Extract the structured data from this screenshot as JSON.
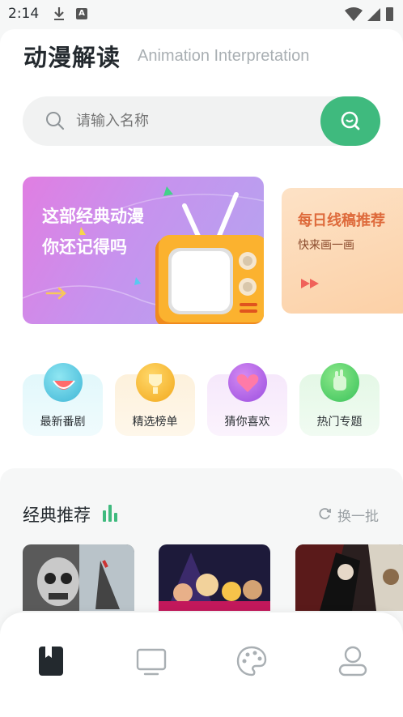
{
  "status": {
    "time": "2:14"
  },
  "header": {
    "title": "动漫解读",
    "subtitle": "Animation Interpretation"
  },
  "search": {
    "placeholder": "请输入名称"
  },
  "banners": [
    {
      "line1": "这部经典动漫",
      "line2": "你还记得吗"
    },
    {
      "title": "每日线稿推荐",
      "subtitle": "快来画一画"
    }
  ],
  "categories": [
    {
      "label": "最新番剧",
      "icon": "watermelon-icon"
    },
    {
      "label": "精选榜单",
      "icon": "trophy-icon"
    },
    {
      "label": "猜你喜欢",
      "icon": "heart-icon"
    },
    {
      "label": "热门专题",
      "icon": "fist-icon"
    }
  ],
  "section": {
    "title": "经典推荐",
    "refresh_label": "换一批"
  },
  "nav": [
    {
      "name": "library",
      "icon": "bookmark-book-icon",
      "active": true
    },
    {
      "name": "tv",
      "icon": "tv-icon",
      "active": false
    },
    {
      "name": "palette",
      "icon": "palette-icon",
      "active": false
    },
    {
      "name": "profile",
      "icon": "user-icon",
      "active": false
    }
  ],
  "colors": {
    "accent": "#3fba7e",
    "text": "#23292e"
  }
}
